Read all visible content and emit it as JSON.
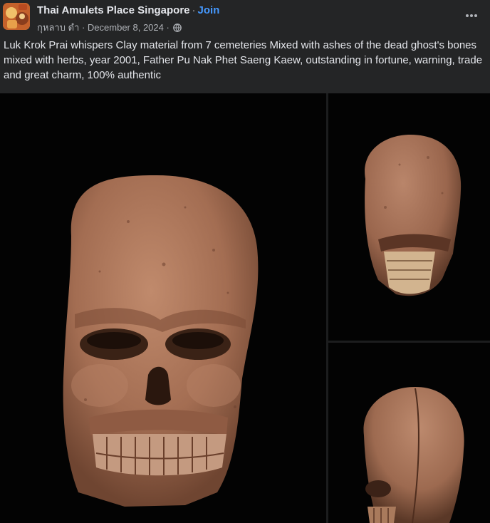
{
  "post": {
    "group_name": "Thai Amulets Place Singapore",
    "separator": "·",
    "join_label": "Join",
    "author": "กุหลาบ ดำ",
    "date": "December 8, 2024",
    "privacy_icon": "globe-icon",
    "more_icon": "more-options-icon",
    "caption": "Luk Krok Prai whispers Clay material from 7 cemeteries Mixed with ashes of the dead ghost's bones mixed with herbs, year 2001, Father Pu Nak Phet Saeng Kaew, outstanding in fortune, warning, trade and great charm, 100% authentic"
  },
  "media": {
    "photos": [
      {
        "subject": "clay skull amulet front view"
      },
      {
        "subject": "clay skull amulet rear view"
      },
      {
        "subject": "clay skull amulet side view"
      }
    ]
  },
  "colors": {
    "background": "#242526",
    "text_primary": "#e4e6eb",
    "text_secondary": "#b0b3b8",
    "link": "#4599ff",
    "photo_background": "#030303",
    "clay": "#a9745a"
  }
}
